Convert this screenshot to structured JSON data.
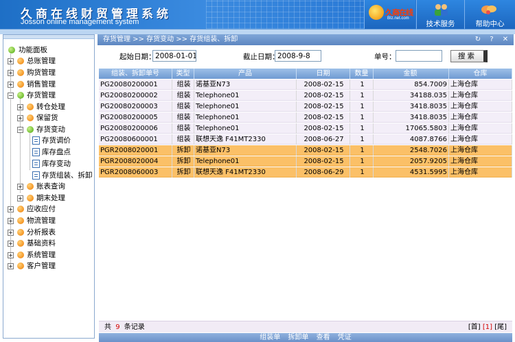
{
  "header": {
    "title": "久商在线财贸管理系统",
    "subtitle": "Josson online management system",
    "logo_text": "久商在线",
    "logo_sub": "BIz.net.com",
    "service_label": "技术服务",
    "help_label": "帮助中心"
  },
  "sidebar": {
    "root": "功能面板",
    "items": [
      {
        "label": "总账管理"
      },
      {
        "label": "购货管理"
      },
      {
        "label": "销售管理"
      },
      {
        "label": "存货管理"
      },
      {
        "label": "转仓处理"
      },
      {
        "label": "保留货"
      },
      {
        "label": "存货变动"
      },
      {
        "label": "存货调价"
      },
      {
        "label": "库存盘点"
      },
      {
        "label": "库存变动"
      },
      {
        "label": "存货组装、拆卸"
      },
      {
        "label": "账表查询"
      },
      {
        "label": "期末处理"
      },
      {
        "label": "应收应付"
      },
      {
        "label": "物流管理"
      },
      {
        "label": "分析报表"
      },
      {
        "label": "基础资料"
      },
      {
        "label": "系统管理"
      },
      {
        "label": "客户管理"
      }
    ]
  },
  "breadcrumb": "存货管理 >> 存货变动 >> 存货组装、拆卸",
  "search": {
    "start_label": "起始日期：",
    "start_value": "2008-01-01",
    "end_label": "截止日期：",
    "end_value": "2008-9-8",
    "no_label": "单号：",
    "no_value": "",
    "button": "搜索"
  },
  "table": {
    "columns": [
      "组装、拆卸单号",
      "类型",
      "产品",
      "日期",
      "数量",
      "金额",
      "仓库"
    ],
    "rows": [
      {
        "no": "PG20080200001",
        "type": "组装",
        "product": "诺基亚N73",
        "date": "2008-02-15",
        "qty": "1",
        "amount": "854.7009",
        "wh": "上海仓库"
      },
      {
        "no": "PG20080200002",
        "type": "组装",
        "product": "Telephone01",
        "date": "2008-02-15",
        "qty": "1",
        "amount": "34188.035",
        "wh": "上海仓库"
      },
      {
        "no": "PG20080200003",
        "type": "组装",
        "product": "Telephone01",
        "date": "2008-02-15",
        "qty": "1",
        "amount": "3418.8035",
        "wh": "上海仓库"
      },
      {
        "no": "PG20080200005",
        "type": "组装",
        "product": "Telephone01",
        "date": "2008-02-15",
        "qty": "1",
        "amount": "3418.8035",
        "wh": "上海仓库"
      },
      {
        "no": "PG20080200006",
        "type": "组装",
        "product": "Telephone01",
        "date": "2008-02-15",
        "qty": "1",
        "amount": "17065.5803",
        "wh": "上海仓库"
      },
      {
        "no": "PG20080600001",
        "type": "组装",
        "product": "联想天逸 F41MT2330",
        "date": "2008-06-27",
        "qty": "1",
        "amount": "4087.8766",
        "wh": "上海仓库"
      },
      {
        "no": "PGR2008020001",
        "type": "拆卸",
        "product": "诺基亚N73",
        "date": "2008-02-15",
        "qty": "1",
        "amount": "2548.7026",
        "wh": "上海仓库"
      },
      {
        "no": "PGR2008020004",
        "type": "拆卸",
        "product": "Telephone01",
        "date": "2008-02-15",
        "qty": "1",
        "amount": "2057.9205",
        "wh": "上海仓库"
      },
      {
        "no": "PGR2008060003",
        "type": "拆卸",
        "product": "联想天逸 F41MT2330",
        "date": "2008-06-29",
        "qty": "1",
        "amount": "4531.5995",
        "wh": "上海仓库"
      }
    ]
  },
  "footer": {
    "count_prefix": "共",
    "count": "9",
    "count_suffix": "条记录",
    "pager_first": "[首]",
    "pager_page": "[1]",
    "pager_last": "[尾]"
  },
  "bottom_actions": [
    "组装单",
    "拆卸单",
    "查看",
    "凭证"
  ],
  "colors": {
    "header": "#2a7ad6",
    "highlight_row": "#fbc067",
    "normal_row": "#f3eef8",
    "count": "#d40000"
  }
}
